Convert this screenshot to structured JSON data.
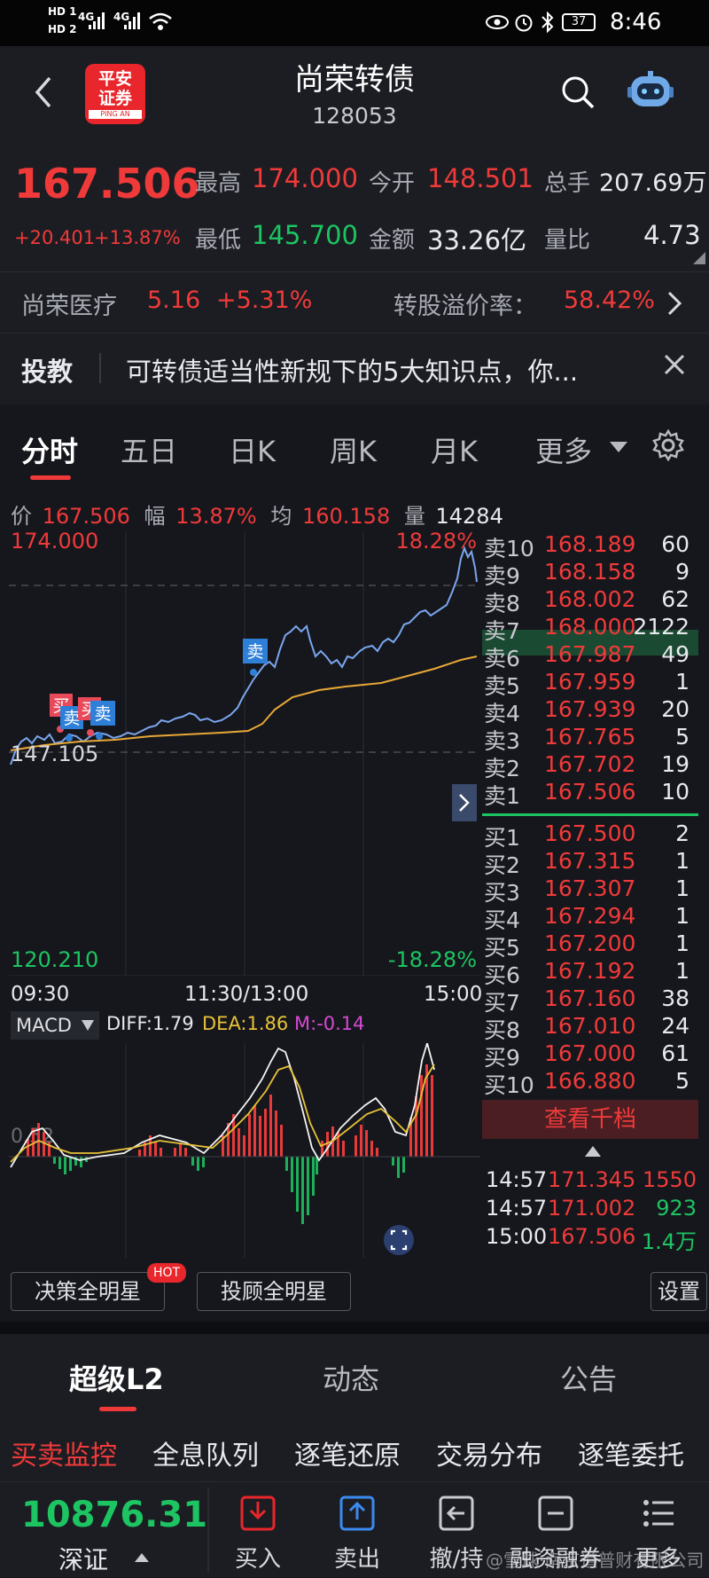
{
  "status": {
    "time": "8:46",
    "battery": "37",
    "net1": "4G",
    "net2": "4G",
    "hd1": "HD 1",
    "hd2": "HD 2"
  },
  "header": {
    "title": "尚荣转债",
    "code": "128053",
    "logo_line1": "平安",
    "logo_line2": "证券",
    "logo_sub": "PING AN"
  },
  "quote": {
    "price": "167.506",
    "change": "+20.401",
    "change_pct": "+13.87%",
    "high_label": "最高",
    "high": "174.000",
    "open_label": "今开",
    "open": "148.501",
    "volume_label": "总手",
    "volume": "207.69万",
    "low_label": "最低",
    "low": "145.700",
    "amount_label": "金额",
    "amount": "33.26亿",
    "ratio_label": "量比",
    "ratio": "4.73"
  },
  "stock": {
    "name": "尚荣医疗",
    "price": "5.16",
    "pct": "+5.31%",
    "premium_label": "转股溢价率：",
    "premium": "58.42%"
  },
  "news": {
    "tag": "投教",
    "text": "可转债适当性新规下的5大知识点，你..."
  },
  "tabs": [
    "分时",
    "五日",
    "日K",
    "周K",
    "月K",
    "更多"
  ],
  "info": {
    "price_label": "价",
    "price": "167.506",
    "range_label": "幅",
    "range": "13.87%",
    "avg_label": "均",
    "avg": "160.158",
    "vol_label": "量",
    "vol": "14284"
  },
  "chart": {
    "top_price": "174.000",
    "top_pct": "18.28%",
    "base_price": "147.105",
    "bottom_price": "120.210",
    "bottom_pct": "-18.28%",
    "time_start": "09:30",
    "time_mid": "11:30/13:00",
    "time_end": "15:00",
    "buy_tag": "买",
    "sell_tag": "卖"
  },
  "macd": {
    "name": "MACD",
    "diff": "DIFF:1.79",
    "dea": "DEA:1.86",
    "m": "M:-0.14",
    "level": "0.52"
  },
  "orderbook": {
    "asks": [
      {
        "label": "卖10",
        "price": "168.189",
        "vol": "60"
      },
      {
        "label": "卖9",
        "price": "168.158",
        "vol": "9"
      },
      {
        "label": "卖8",
        "price": "168.002",
        "vol": "62"
      },
      {
        "label": "卖7",
        "price": "168.000",
        "vol": "2122"
      },
      {
        "label": "卖6",
        "price": "167.987",
        "vol": "49"
      },
      {
        "label": "卖5",
        "price": "167.959",
        "vol": "1"
      },
      {
        "label": "卖4",
        "price": "167.939",
        "vol": "20"
      },
      {
        "label": "卖3",
        "price": "167.765",
        "vol": "5"
      },
      {
        "label": "卖2",
        "price": "167.702",
        "vol": "19"
      },
      {
        "label": "卖1",
        "price": "167.506",
        "vol": "10"
      }
    ],
    "bids": [
      {
        "label": "买1",
        "price": "167.500",
        "vol": "2"
      },
      {
        "label": "买2",
        "price": "167.315",
        "vol": "1"
      },
      {
        "label": "买3",
        "price": "167.307",
        "vol": "1"
      },
      {
        "label": "买4",
        "price": "167.294",
        "vol": "1"
      },
      {
        "label": "买5",
        "price": "167.200",
        "vol": "1"
      },
      {
        "label": "买6",
        "price": "167.192",
        "vol": "1"
      },
      {
        "label": "买7",
        "price": "167.160",
        "vol": "38"
      },
      {
        "label": "买8",
        "price": "167.010",
        "vol": "24"
      },
      {
        "label": "买9",
        "price": "167.000",
        "vol": "61"
      },
      {
        "label": "买10",
        "price": "166.880",
        "vol": "5"
      }
    ],
    "more_btn": "查看千档"
  },
  "trades": [
    {
      "time": "14:57",
      "price": "171.345",
      "vol": "1550",
      "color": "red"
    },
    {
      "time": "14:57",
      "price": "171.002",
      "vol": "923",
      "color": "green"
    },
    {
      "time": "15:00",
      "price": "167.506",
      "vol": "1.4万",
      "color": "green"
    }
  ],
  "buttons": {
    "decision": "决策全明星",
    "hot": "HOT",
    "advisor": "投顾全明星",
    "settings": "设置"
  },
  "l2tabs": [
    "超级L2",
    "动态",
    "公告"
  ],
  "subtabs": [
    "买卖监控",
    "全息队列",
    "逐笔还原",
    "交易分布",
    "逐笔委托"
  ],
  "bottom": {
    "index_value": "10876.31",
    "index_name": "深证",
    "items": [
      {
        "label": "买入",
        "icon": "buy-icon"
      },
      {
        "label": "卖出",
        "icon": "sell-icon"
      },
      {
        "label": "撤/持",
        "icon": "cancel-icon"
      },
      {
        "label": "融资融券",
        "icon": "margin-icon"
      },
      {
        "label": "更多",
        "icon": "more-icon"
      }
    ]
  },
  "watermark": "@雪球·南京道普财有限公司"
}
